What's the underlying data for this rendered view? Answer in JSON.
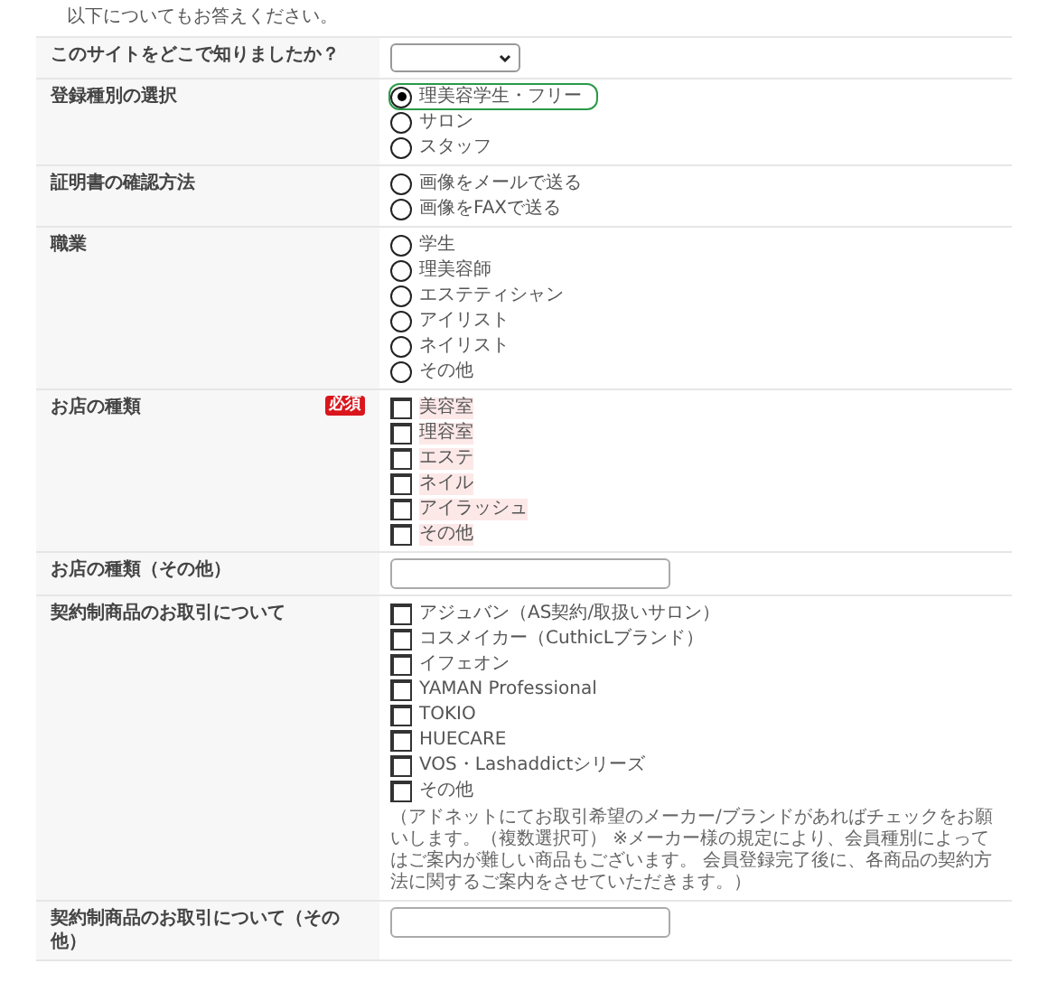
{
  "intro": "以下についてもお答えください。",
  "rows": [
    {
      "kind": "select",
      "label": "このサイトをどこで知りましたか？"
    },
    {
      "kind": "radio",
      "label": "登録種別の選択",
      "options": [
        {
          "label": "理美容学生・フリー",
          "selected": true
        },
        {
          "label": "サロン",
          "selected": false
        },
        {
          "label": "スタッフ",
          "selected": false
        }
      ]
    },
    {
      "kind": "radio",
      "label": "証明書の確認方法",
      "options": [
        {
          "label": "画像をメールで送る",
          "selected": false
        },
        {
          "label": "画像をFAXで送る",
          "selected": false
        }
      ]
    },
    {
      "kind": "radio",
      "label": "職業",
      "options": [
        {
          "label": "学生",
          "selected": false
        },
        {
          "label": "理美容師",
          "selected": false
        },
        {
          "label": "エステティシャン",
          "selected": false
        },
        {
          "label": "アイリスト",
          "selected": false
        },
        {
          "label": "ネイリスト",
          "selected": false
        },
        {
          "label": "その他",
          "selected": false
        }
      ]
    },
    {
      "kind": "checkbox",
      "label": "お店の種類",
      "badge": "必須",
      "options": [
        {
          "label": "美容室",
          "checked": false
        },
        {
          "label": "理容室",
          "checked": false
        },
        {
          "label": "エステ",
          "checked": false
        },
        {
          "label": "ネイル",
          "checked": false
        },
        {
          "label": "アイラッシュ",
          "checked": false
        },
        {
          "label": "その他",
          "checked": false
        }
      ]
    },
    {
      "kind": "text",
      "label": "お店の種類（その他）"
    },
    {
      "kind": "checkbox",
      "label": "契約制商品のお取引について",
      "options": [
        {
          "label": "アジュバン（AS契約/取扱いサロン）",
          "checked": false
        },
        {
          "label": "コスメイカー（CuthicLブランド）",
          "checked": false
        },
        {
          "label": "イフェオン",
          "checked": false
        },
        {
          "label": "YAMAN Professional",
          "checked": false
        },
        {
          "label": "TOKIO",
          "checked": false
        },
        {
          "label": "HUECARE",
          "checked": false
        },
        {
          "label": "VOS・Lashaddictシリーズ",
          "checked": false
        },
        {
          "label": "その他",
          "checked": false
        }
      ],
      "note": "（アドネットにてお取引希望のメーカー/ブランドがあればチェックをお願いします。（複数選択可） ※メーカー様の規定により、会員種別によってはご案内が難しい商品もございます。 会員登録完了後に、各商品の契約方法に関するご案内をさせていただきます。）"
    },
    {
      "kind": "text",
      "label": "契約制商品のお取引について（その他）"
    }
  ]
}
